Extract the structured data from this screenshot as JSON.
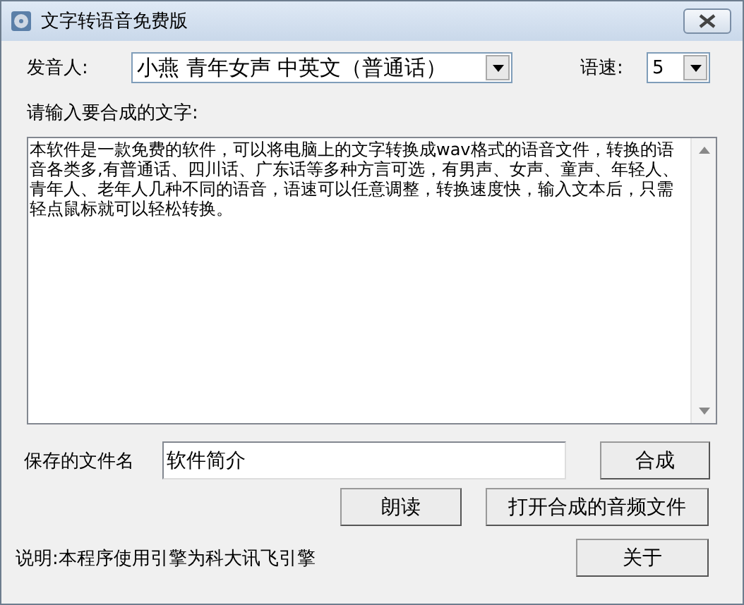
{
  "window": {
    "title": "文字转语音免费版"
  },
  "speaker": {
    "label": "发音人:",
    "value": "小燕  青年女声  中英文（普通话）"
  },
  "speed": {
    "label": "语速:",
    "value": "5"
  },
  "text_input": {
    "label": "请输入要合成的文字:",
    "value": "本软件是一款免费的软件，可以将电脑上的文字转换成wav格式的语音文件，转换的语音各类多,有普通话、四川话、广东话等多种方言可选，有男声、女声、童声、年轻人、青年人、老年人几种不同的语音，语速可以任意调整，转换速度快，输入文本后，只需轻点鼠标就可以轻松转换。"
  },
  "filename": {
    "label": "保存的文件名",
    "value": "软件简介"
  },
  "buttons": {
    "synthesize": "合成",
    "read_aloud": "朗读",
    "open_audio": "打开合成的音频文件",
    "about": "关于"
  },
  "note": "说明:本程序使用引擎为科大讯飞引擎"
}
